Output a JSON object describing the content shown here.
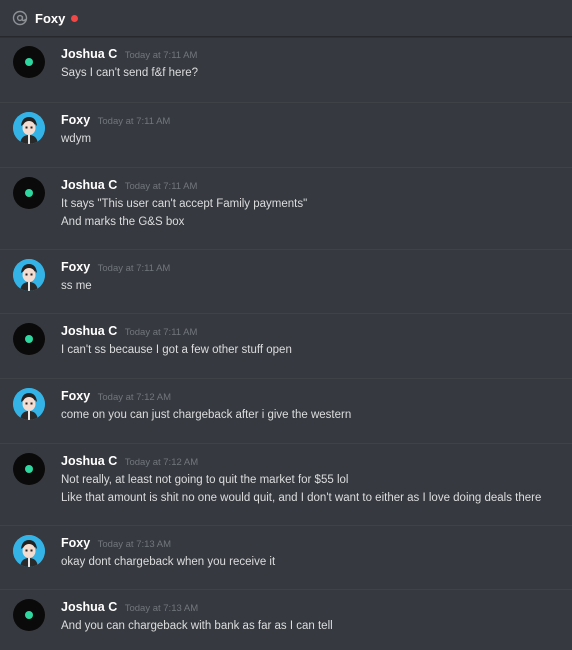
{
  "header": {
    "channel_name": "Foxy",
    "status_color": "#f04747"
  },
  "messages": [
    {
      "author": "Joshua C",
      "avatar": "dark-avatar",
      "timestamp": "Today at 7:11 AM",
      "lines": [
        "Says I can't send f&f here?"
      ]
    },
    {
      "author": "Foxy",
      "avatar": "foxy-avatar",
      "timestamp": "Today at 7:11 AM",
      "lines": [
        "wdym"
      ]
    },
    {
      "author": "Joshua C",
      "avatar": "dark-avatar",
      "timestamp": "Today at 7:11 AM",
      "lines": [
        "It says \"This user can't accept Family payments\"",
        "And marks the G&S box"
      ]
    },
    {
      "author": "Foxy",
      "avatar": "foxy-avatar",
      "timestamp": "Today at 7:11 AM",
      "lines": [
        "ss me"
      ]
    },
    {
      "author": "Joshua C",
      "avatar": "dark-avatar",
      "timestamp": "Today at 7:11 AM",
      "lines": [
        "I can't ss because I got a few other stuff open"
      ]
    },
    {
      "author": "Foxy",
      "avatar": "foxy-avatar",
      "timestamp": "Today at 7:12 AM",
      "lines": [
        "come on you can just chargeback after i give the western"
      ]
    },
    {
      "author": "Joshua C",
      "avatar": "dark-avatar",
      "timestamp": "Today at 7:12 AM",
      "lines": [
        "Not really, at least not going to quit the market for $55 lol",
        "Like that amount is shit no one would quit, and I don't want to either as I love doing deals there"
      ]
    },
    {
      "author": "Foxy",
      "avatar": "foxy-avatar",
      "timestamp": "Today at 7:13 AM",
      "lines": [
        "okay dont chargeback when you receive it"
      ]
    },
    {
      "author": "Joshua C",
      "avatar": "dark-avatar",
      "timestamp": "Today at 7:13 AM",
      "lines": [
        "And you can chargeback with bank as far as I can tell"
      ]
    }
  ]
}
